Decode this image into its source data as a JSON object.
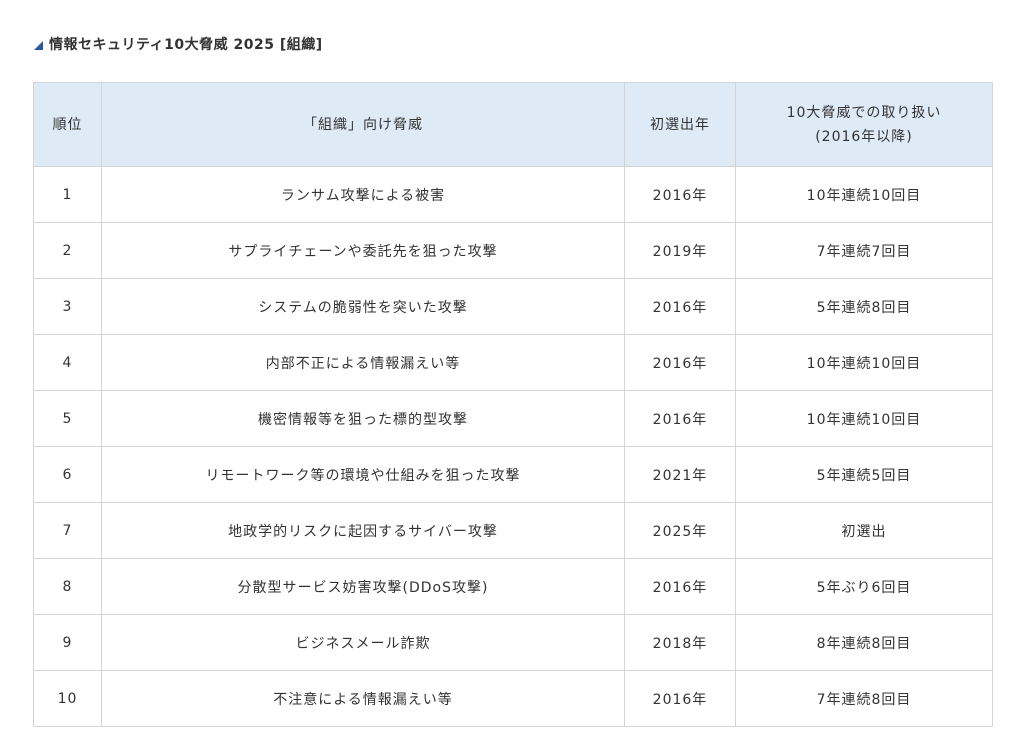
{
  "heading": {
    "marker_icon": "triangle-marker-icon",
    "title": "情報セキュリティ10大脅威 2025 [組織]"
  },
  "colors": {
    "header_bg": "#deeaf6",
    "border": "#d4d4d4",
    "marker": "#2a5b9c",
    "text": "#333333"
  },
  "table": {
    "headers": {
      "rank": "順位",
      "threat": "「組織」向け脅威",
      "first_year": "初選出年",
      "handling_line1": "10大脅威での取り扱い",
      "handling_line2": "(2016年以降)"
    },
    "rows": [
      {
        "rank": "1",
        "threat": "ランサム攻撃による被害",
        "first_year": "2016年",
        "handling": "10年連続10回目"
      },
      {
        "rank": "2",
        "threat": "サプライチェーンや委託先を狙った攻撃",
        "first_year": "2019年",
        "handling": "7年連続7回目"
      },
      {
        "rank": "3",
        "threat": "システムの脆弱性を突いた攻撃",
        "first_year": "2016年",
        "handling": "5年連続8回目"
      },
      {
        "rank": "4",
        "threat": "内部不正による情報漏えい等",
        "first_year": "2016年",
        "handling": "10年連続10回目"
      },
      {
        "rank": "5",
        "threat": "機密情報等を狙った標的型攻撃",
        "first_year": "2016年",
        "handling": "10年連続10回目"
      },
      {
        "rank": "6",
        "threat": "リモートワーク等の環境や仕組みを狙った攻撃",
        "first_year": "2021年",
        "handling": "5年連続5回目"
      },
      {
        "rank": "7",
        "threat": "地政学的リスクに起因するサイバー攻撃",
        "first_year": "2025年",
        "handling": "初選出"
      },
      {
        "rank": "8",
        "threat": "分散型サービス妨害攻撃(DDoS攻撃)",
        "first_year": "2016年",
        "handling": "5年ぶり6回目"
      },
      {
        "rank": "9",
        "threat": "ビジネスメール詐欺",
        "first_year": "2018年",
        "handling": "8年連続8回目"
      },
      {
        "rank": "10",
        "threat": "不注意による情報漏えい等",
        "first_year": "2016年",
        "handling": "7年連続8回目"
      }
    ]
  }
}
